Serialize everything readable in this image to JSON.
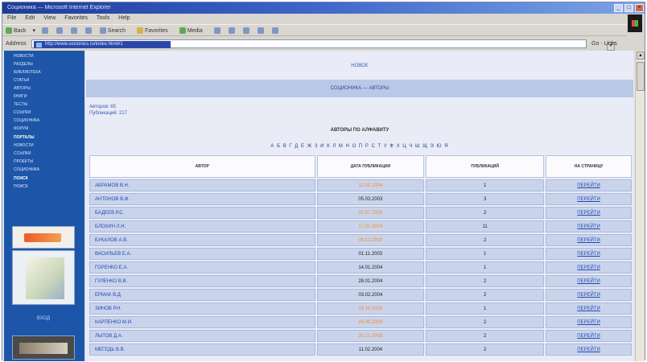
{
  "window": {
    "title": "Соционика — Microsoft Internet Explorer"
  },
  "menu": [
    "File",
    "Edit",
    "View",
    "Favorites",
    "Tools",
    "Help"
  ],
  "toolbar": {
    "back": "Back",
    "search": "Search",
    "favorites": "Favorites",
    "media": "Media"
  },
  "address": {
    "label": "Address",
    "url": "http://www.socionics.ru/index.html#1",
    "go": "Go",
    "links": "Links"
  },
  "sidebar": {
    "items": [
      "НОВОСТИ",
      "РАЗДЕЛЫ",
      "БИБЛИОТЕКА",
      "СТАТЬИ",
      "АВТОРЫ",
      "КНИГИ",
      "ТЕСТЫ",
      "ССЫЛКИ",
      "СОЦИОНИКА",
      "ФОРУМ"
    ],
    "section_head_1": "ПОРТАЛЫ",
    "section_items_1": [
      "НОВОСТИ",
      "ССЫЛКИ",
      "ПРОЕКТЫ",
      "СОЦИОНИКА"
    ],
    "section_head_2": "ПОИСК",
    "section_items_2": [
      "ПОИСК"
    ],
    "bottom_link": "ВХОД"
  },
  "main": {
    "top_link": "НОВОЕ",
    "band_title": "СОЦИОНИКА — АВТОРЫ",
    "info_line_1": "Авторов: 65",
    "info_line_2": "Публикаций: 217",
    "section_title": "АВТОРЫ ПО АЛФАВИТУ",
    "alphabet": "А Б В Г Д Е Ж З И К Л М Н О П Р С Т У Ф Х Ц Ч Ш Щ Э Ю Я"
  },
  "table": {
    "headers": {
      "author": "АВТОР",
      "date": "ДАТА ПУБЛИКАЦИИ",
      "count": "ПУБЛИКАЦИЙ",
      "link": "НА СТРАНИЦУ"
    },
    "rows": [
      {
        "author": "АБРАМОВ В.Н.",
        "date": "12.01.2004",
        "date_highlight": true,
        "count": "1",
        "link": "ПЕРЕЙТИ"
      },
      {
        "author": "АНТОНОВ В.Ф.",
        "date": "05.03.2003",
        "date_highlight": false,
        "count": "3",
        "link": "ПЕРЕЙТИ"
      },
      {
        "author": "БАДЕЕВ Р.С.",
        "date": "22.07.2003",
        "date_highlight": true,
        "count": "2",
        "link": "ПЕРЕЙТИ"
      },
      {
        "author": "БЛОХИН Л.Н.",
        "date": "17.02.2004",
        "date_highlight": true,
        "count": "11",
        "link": "ПЕРЕЙТИ"
      },
      {
        "author": "БУКАЛОВ А.В.",
        "date": "09.12.2003",
        "date_highlight": true,
        "count": "2",
        "link": "ПЕРЕЙТИ"
      },
      {
        "author": "ВАСИЛЬЕВ Е.А.",
        "date": "01.11.2003",
        "date_highlight": false,
        "count": "1",
        "link": "ПЕРЕЙТИ"
      },
      {
        "author": "ГОРЕНКО Е.А.",
        "date": "14.01.2004",
        "date_highlight": false,
        "count": "1",
        "link": "ПЕРЕЙТИ"
      },
      {
        "author": "ГУЛЕНКО В.В.",
        "date": "28.01.2004",
        "date_highlight": false,
        "count": "2",
        "link": "ПЕРЕЙТИ"
      },
      {
        "author": "ЕРМАК В.Д.",
        "date": "03.02.2004",
        "date_highlight": false,
        "count": "2",
        "link": "ПЕРЕЙТИ"
      },
      {
        "author": "ЗИНОВ Р.Н.",
        "date": "19.10.2003",
        "date_highlight": true,
        "count": "1",
        "link": "ПЕРЕЙТИ"
      },
      {
        "author": "КАРПЕНКО М.И.",
        "date": "26.09.2003",
        "date_highlight": true,
        "count": "2",
        "link": "ПЕРЕЙТИ"
      },
      {
        "author": "ЛЫТОВ Д.А.",
        "date": "30.12.2003",
        "date_highlight": true,
        "count": "2",
        "link": "ПЕРЕЙТИ"
      },
      {
        "author": "МЕГЕДЬ В.В.",
        "date": "11.02.2004",
        "date_highlight": false,
        "count": "2",
        "link": "ПЕРЕЙТИ"
      }
    ]
  },
  "colors": {
    "titlebar": "#1e3c9a",
    "sidebar": "#1d56a8",
    "link": "#2448b3",
    "highlight_date": "#f28c28",
    "table_row": "#c9d4ec"
  }
}
